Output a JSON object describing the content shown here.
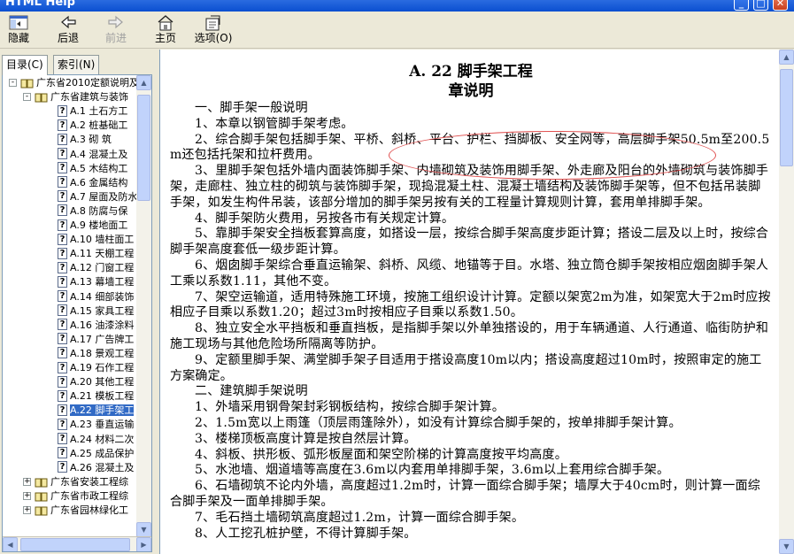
{
  "window": {
    "title": "HTML Help",
    "controls": [
      "_",
      "□",
      "✕"
    ]
  },
  "toolbar": {
    "hide": "隐藏",
    "back": "后退",
    "forward": "前进",
    "home": "主页",
    "options": "选项(O)"
  },
  "tabs": [
    "目录(C)",
    "索引(N)"
  ],
  "tree": {
    "root": "广东省2010定额说明及",
    "sub": "广东省建筑与装饰",
    "items": [
      {
        "code": "A.1",
        "label": "土石方工"
      },
      {
        "code": "A.2",
        "label": "桩基础工"
      },
      {
        "code": "A.3",
        "label": "砌  筑"
      },
      {
        "code": "A.4",
        "label": "混凝土及"
      },
      {
        "code": "A.5",
        "label": "木结构工"
      },
      {
        "code": "A.6",
        "label": "金属结构"
      },
      {
        "code": "A.7",
        "label": "屋面及防水"
      },
      {
        "code": "A.8",
        "label": "防腐与保"
      },
      {
        "code": "A.9",
        "label": "楼地面工"
      },
      {
        "code": "A.10",
        "label": "墙柱面工"
      },
      {
        "code": "A.11",
        "label": "天棚工程"
      },
      {
        "code": "A.12",
        "label": "门窗工程"
      },
      {
        "code": "A.13",
        "label": "幕墙工程"
      },
      {
        "code": "A.14",
        "label": "细部装饰"
      },
      {
        "code": "A.15",
        "label": "家具工程"
      },
      {
        "code": "A.16",
        "label": "油漆涂料"
      },
      {
        "code": "A.17",
        "label": "广告牌工"
      },
      {
        "code": "A.18",
        "label": "景观工程"
      },
      {
        "code": "A.19",
        "label": "石作工程"
      },
      {
        "code": "A.20",
        "label": "其他工程"
      },
      {
        "code": "A.21",
        "label": "模板工程"
      },
      {
        "code": "A.22",
        "label": "脚手架工"
      },
      {
        "code": "A.23",
        "label": "垂直运输"
      },
      {
        "code": "A.24",
        "label": "材料二次"
      },
      {
        "code": "A.25",
        "label": "成品保护"
      },
      {
        "code": "A.26",
        "label": "混凝土及"
      }
    ],
    "selected_index": 21,
    "others": [
      "广东省安装工程综",
      "广东省市政工程综",
      "广东省园林绿化工"
    ]
  },
  "doc": {
    "title": "A. 22  脚手架工程",
    "subtitle": "章说明",
    "paragraphs": [
      "一、脚手架一般说明",
      "1、本章以钢管脚手架考虑。",
      "2、综合脚手架包括脚手架、平桥、斜桥、平台、护栏、挡脚板、安全网等，高层脚手架50.5m至200.5m还包括托架和拉杆费用。",
      "3、里脚手架包括外墙内面装饰脚手架、内墙砌筑及装饰用脚手架、外走廊及阳台的外墙砌筑与装饰脚手架，走廊柱、独立柱的砌筑与装饰脚手架，现捣混凝土柱、混凝土墙结构及装饰脚手架等，但不包括吊装脚手架，如发生构件吊装，该部分增加的脚手架另按有关的工程量计算规则计算，套用单排脚手架。",
      "4、脚手架防火费用，另按各市有关规定计算。",
      "5、靠脚手架安全挡板套算高度，如搭设一层，按综合脚手架高度步距计算；搭设二层及以上时，按综合脚手架高度套低一级步距计算。",
      "6、烟囱脚手架综合垂直运输架、斜桥、风缆、地锚等于目。水塔、独立筒仓脚手架按相应烟囱脚手架人工乘以系数1.11，其他不变。",
      "7、架空运输道，适用特殊施工环境，按施工组织设计计算。定额以架宽2m为准，如架宽大于2m时应按相应子目乘以系数1.20；超过3m时按相应子目乘以系数1.50。",
      "8、独立安全水平挡板和垂直挡板，是指脚手架以外单独搭设的，用于车辆通道、人行通道、临街防护和施工现场与其他危险场所隔离等防护。",
      "9、定额里脚手架、满堂脚手架子目适用于搭设高度10m以内；搭设高度超过10m时，按照审定的施工方案确定。",
      "二、建筑脚手架说明",
      "1、外墙采用钢骨架封彩钢板结构，按综合脚手架计算。",
      "2、1.5m宽以上雨篷（顶层雨篷除外），如没有计算综合脚手架的，按单排脚手架计算。",
      "3、楼梯顶板高度计算是按自然层计算。",
      "4、斜板、拱形板、弧形板屋面和架空阶梯的计算高度按平均高度。",
      "5、水池墙、烟道墙等高度在3.6m以内套用单排脚手架，3.6m以上套用综合脚手架。",
      "6、石墙砌筑不论内外墙，高度超过1.2m时，计算一面综合脚手架；墙厚大于40cm时，则计算一面综合脚手架及一面单排脚手架。",
      "7、毛石挡土墙砌筑高度超过1.2m，计算一面综合脚手架。",
      "8、人工挖孔桩护壁，不得计算脚手架。"
    ]
  },
  "colors": {
    "title_bar": "#0a4fd0",
    "selection": "#316ac5",
    "annotation_oval": "#e05050",
    "chrome": "#ece9d8"
  }
}
